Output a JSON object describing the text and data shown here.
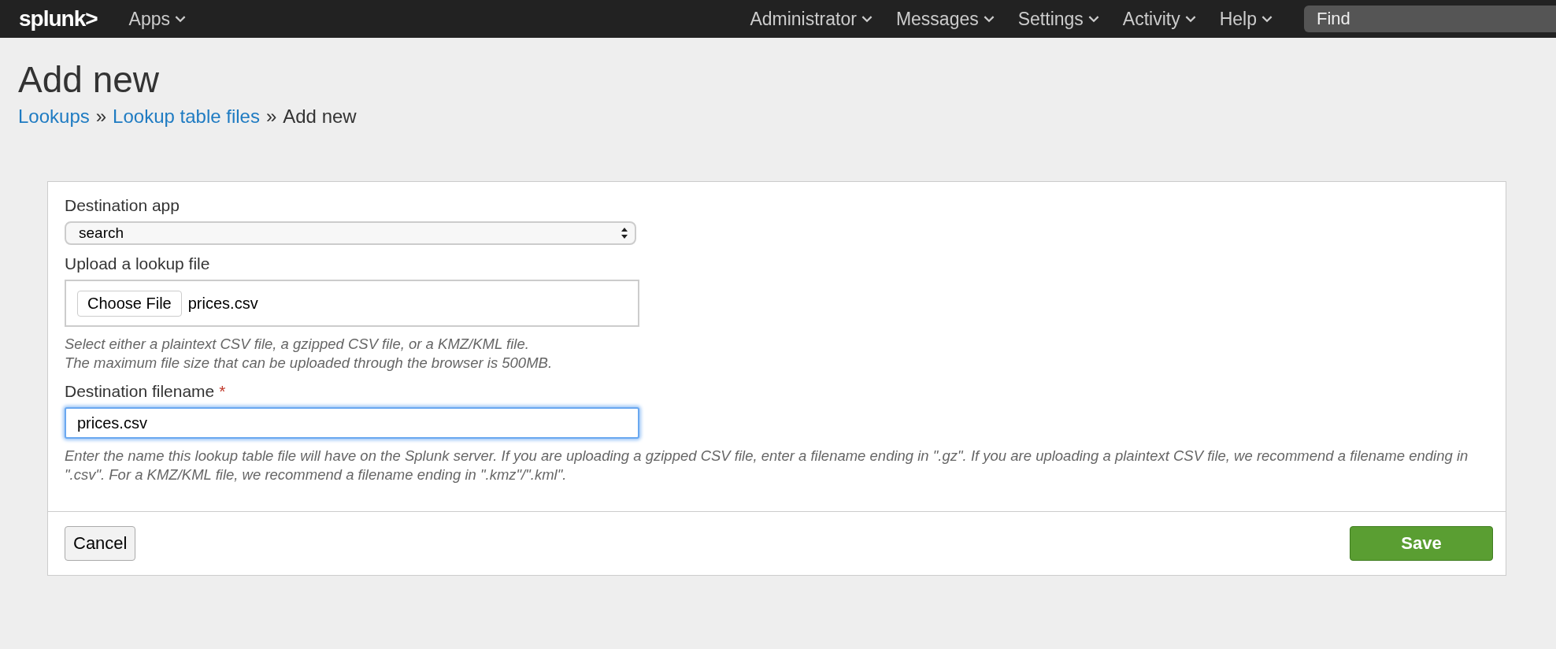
{
  "top_bar": {
    "logo": "splunk>",
    "apps_menu": "Apps",
    "menus": [
      "Administrator",
      "Messages",
      "Settings",
      "Activity",
      "Help"
    ],
    "search": {
      "placeholder": "Find"
    }
  },
  "page": {
    "title": "Add new",
    "breadcrumb": [
      {
        "label": "Lookups",
        "kind": "link"
      },
      {
        "label": "Lookup table files",
        "kind": "link"
      },
      {
        "label": "Add new",
        "kind": "current"
      }
    ],
    "separator": "»"
  },
  "form": {
    "fields": [
      {
        "kind": "select",
        "label": "Destination app",
        "value": "search"
      },
      {
        "kind": "file",
        "label": "Upload a lookup file",
        "button": "Choose File",
        "value": "prices.csv",
        "help": [
          "Select either a plaintext CSV file, a gzipped CSV file, or a KMZ/KML file.",
          "The maximum file size that can be uploaded through the browser is 500MB."
        ]
      },
      {
        "kind": "text",
        "label": "Destination filename",
        "required_mark": "*",
        "value": "prices.csv",
        "focused": true,
        "help": [
          "Enter the name this lookup table file will have on the Splunk server. If you are uploading a gzipped CSV file, enter a filename ending in \".gz\". If you are uploading a plaintext CSV file, we recommend a filename ending in \".csv\". For a KMZ/KML file, we recommend a filename ending in \".kmz\"/\".kml\"."
        ]
      }
    ],
    "buttons": {
      "cancel": "Cancel",
      "save": "Save"
    }
  }
}
